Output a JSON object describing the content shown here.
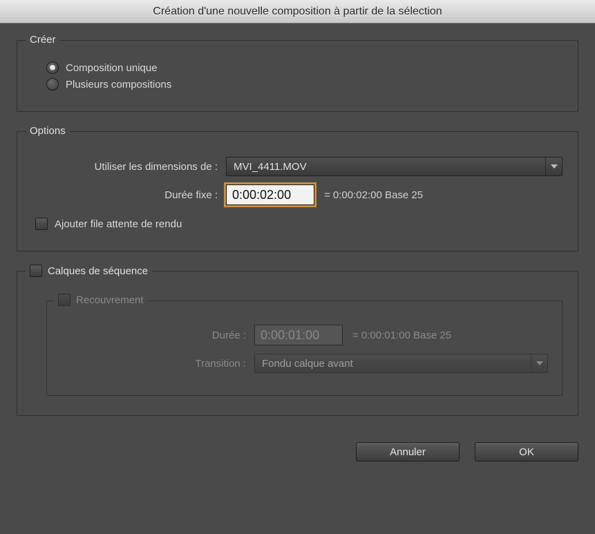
{
  "window": {
    "title": "Création d'une nouvelle composition à partir de la sélection"
  },
  "create": {
    "legend": "Créer",
    "option_single": "Composition unique",
    "option_multiple": "Plusieurs compositions",
    "selected": "single"
  },
  "options": {
    "legend": "Options",
    "dimensions_label": "Utiliser les dimensions de :",
    "dimensions_value": "MVI_4411.MOV",
    "duration_label": "Durée fixe :",
    "duration_value": "0:00:02:00",
    "duration_aux": "= 0:00:02:00  Base 25",
    "add_render_queue": "Ajouter file attente de rendu",
    "add_render_queue_checked": false
  },
  "sequence": {
    "legend": "Calques de séquence",
    "enabled": false,
    "overlap": {
      "legend": "Recouvrement",
      "enabled": false,
      "duration_label": "Durée :",
      "duration_value": "0:00:01:00",
      "duration_aux": "= 0:00:01:00  Base 25",
      "transition_label": "Transition :",
      "transition_value": "Fondu calque avant"
    }
  },
  "buttons": {
    "cancel": "Annuler",
    "ok": "OK"
  }
}
